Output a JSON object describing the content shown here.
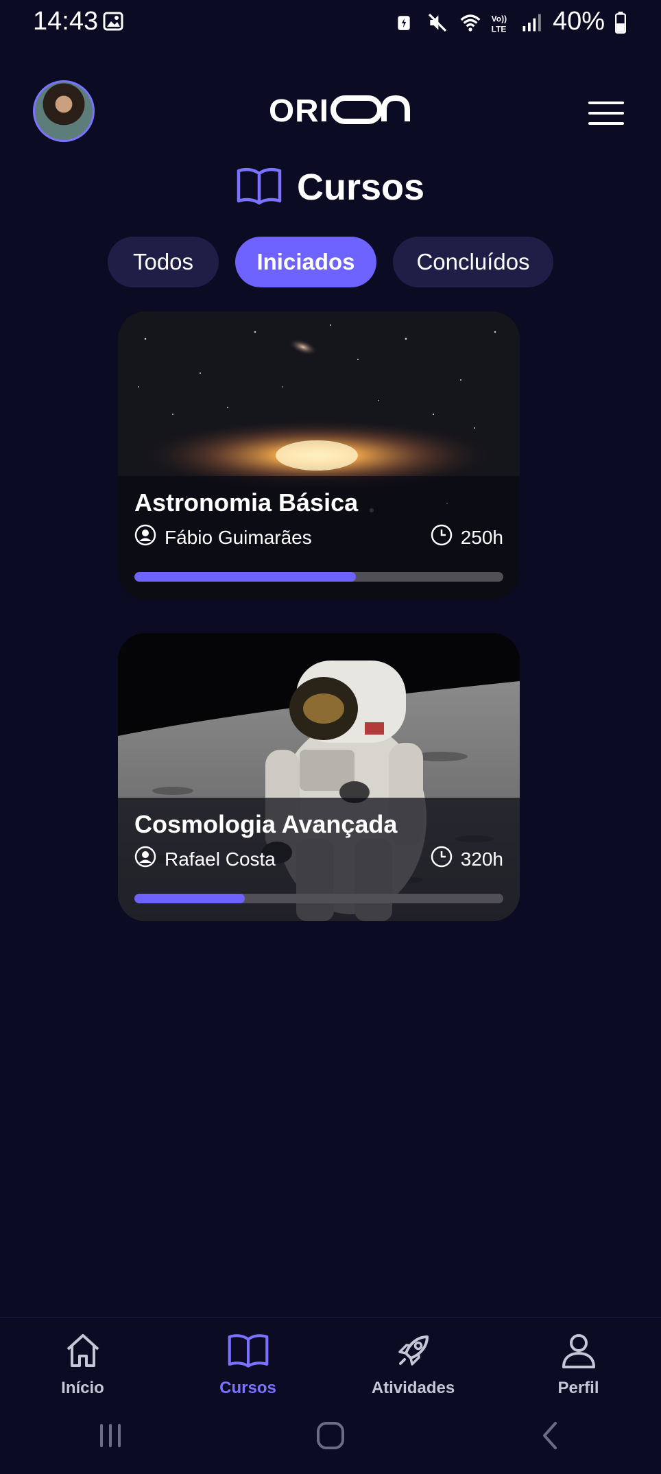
{
  "status_bar": {
    "time": "14:43",
    "battery": "40%",
    "icons": [
      "image-icon",
      "battery-saver-icon",
      "mute-icon",
      "wifi-icon",
      "volte-icon",
      "signal-icon",
      "battery-icon"
    ]
  },
  "header": {
    "logo": "ORION",
    "menu_icon": "hamburger-menu-icon",
    "avatar_icon": "avatar"
  },
  "page": {
    "title": "Cursos",
    "title_icon": "book-icon"
  },
  "tabs": [
    {
      "label": "Todos",
      "active": false
    },
    {
      "label": "Iniciados",
      "active": true
    },
    {
      "label": "Concluídos",
      "active": false
    }
  ],
  "courses": [
    {
      "title": "Astronomia Básica",
      "instructor": "Fábio Guimarães",
      "duration": "250h",
      "progress": 0.6,
      "image": "galaxy-image"
    },
    {
      "title": "Cosmologia Avançada",
      "instructor": "Rafael Costa",
      "duration": "320h",
      "progress": 0.3,
      "image": "astronaut-moon-image"
    }
  ],
  "bottom_nav": [
    {
      "label": "Início",
      "icon": "home-icon",
      "active": false
    },
    {
      "label": "Cursos",
      "icon": "book-icon",
      "active": true
    },
    {
      "label": "Atividades",
      "icon": "rocket-icon",
      "active": false
    },
    {
      "label": "Perfil",
      "icon": "user-icon",
      "active": false
    }
  ],
  "colors": {
    "background": "#0b0b24",
    "accent": "#6f63ff",
    "tab_inactive": "#1f1e46",
    "nav_inactive": "#c5c6d6"
  }
}
